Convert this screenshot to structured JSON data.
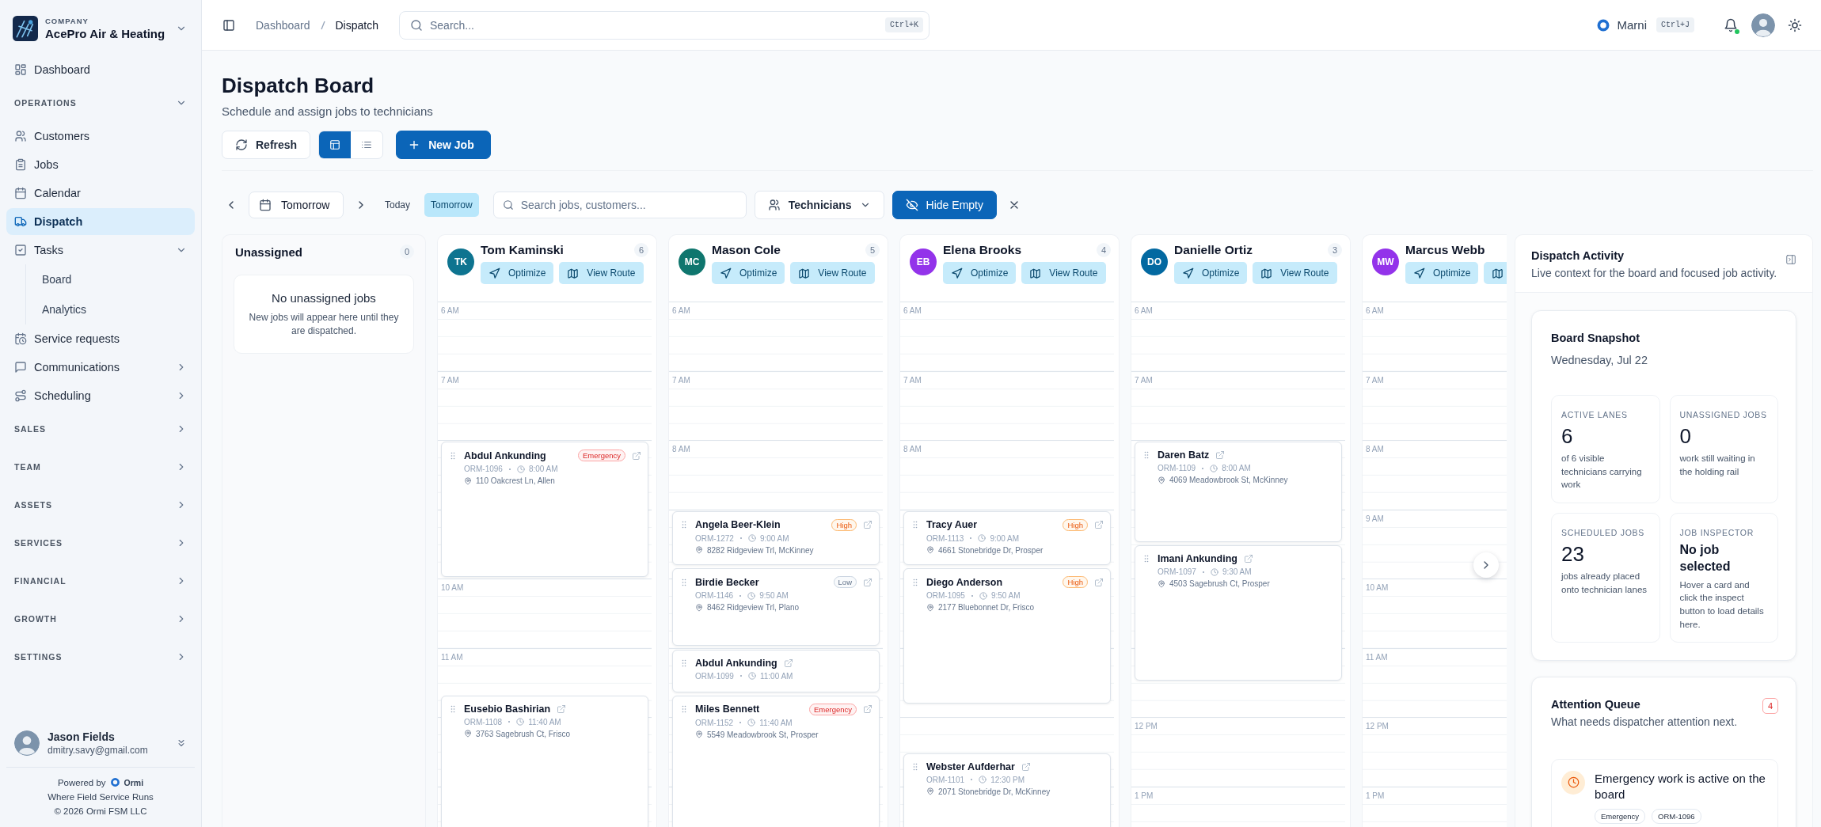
{
  "sidebar": {
    "company_label": "COMPANY",
    "company": "AcePro Air & Heating",
    "nav": [
      {
        "kind": "link",
        "label": "Dashboard",
        "selected": false
      },
      {
        "kind": "section",
        "label": "OPERATIONS",
        "expanded": true,
        "children": [
          {
            "kind": "link",
            "label": "Customers",
            "selected": false
          },
          {
            "kind": "link",
            "label": "Jobs",
            "selected": false
          },
          {
            "kind": "link",
            "label": "Calendar",
            "selected": false
          },
          {
            "kind": "link",
            "label": "Dispatch",
            "selected": true
          },
          {
            "kind": "link",
            "label": "Tasks",
            "selected": false,
            "expanded": true,
            "children": [
              {
                "kind": "sublink",
                "label": "Board",
                "selected": false
              },
              {
                "kind": "sublink",
                "label": "Analytics",
                "selected": false
              }
            ]
          },
          {
            "kind": "link",
            "label": "Service requests",
            "selected": false
          },
          {
            "kind": "link",
            "label": "Communications",
            "selected": false,
            "expanded": false
          },
          {
            "kind": "link",
            "label": "Scheduling",
            "selected": false,
            "expanded": false
          }
        ]
      },
      {
        "kind": "section",
        "label": "SALES",
        "expanded": false
      },
      {
        "kind": "section",
        "label": "TEAM",
        "expanded": false
      },
      {
        "kind": "section",
        "label": "ASSETS",
        "expanded": false
      },
      {
        "kind": "section",
        "label": "SERVICES",
        "expanded": false
      },
      {
        "kind": "section",
        "label": "FINANCIAL",
        "expanded": false
      },
      {
        "kind": "section",
        "label": "GROWTH",
        "expanded": false
      },
      {
        "kind": "section",
        "label": "SETTINGS",
        "expanded": false
      }
    ],
    "user": {
      "name": "Jason Fields",
      "email": "dmitry.savy@gmail.com"
    },
    "footer": {
      "powered_by": "Powered by",
      "brand": "Ormi",
      "tagline": "Where Field Service Runs",
      "copyright": "© 2026 Ormi FSM LLC"
    }
  },
  "header": {
    "breadcrumb": [
      {
        "label": "Dashboard",
        "current": false
      },
      {
        "label": "Dispatch",
        "current": true
      }
    ],
    "search": {
      "placeholder": "Search...",
      "shortcut": "Ctrl+K"
    },
    "assistant": {
      "name": "Marni",
      "shortcut": "Ctrl+J"
    },
    "notifications": {
      "unread": true
    }
  },
  "page": {
    "title": "Dispatch Board",
    "subtitle": "Schedule and assign jobs to technicians",
    "refresh": "Refresh",
    "views": [
      {
        "kind": "board",
        "selected": true
      },
      {
        "kind": "list",
        "selected": false
      }
    ],
    "new_job": "New Job"
  },
  "filters": {
    "date": "Tomorrow",
    "quick_dates": [
      {
        "label": "Today",
        "selected": false
      },
      {
        "label": "Tomorrow",
        "selected": true
      }
    ],
    "search": {
      "placeholder": "Search jobs, customers..."
    },
    "technicians": "Technicians",
    "hide_empty": {
      "label": "Hide Empty",
      "on": true
    }
  },
  "board": {
    "unassigned": {
      "title": "Unassigned",
      "count": "0",
      "empty_title": "No unassigned jobs",
      "empty_text": "New jobs will appear here until they are dispatched."
    },
    "lanes": [
      {
        "initials": "TK",
        "name": "Tom Kaminski",
        "count": "6",
        "color": "#0e7490",
        "actions": [
          {
            "kind": "optimize",
            "label": "Optimize"
          },
          {
            "kind": "route",
            "label": "View Route"
          }
        ],
        "hours": [
          "6 AM",
          "7 AM",
          "10 AM",
          "11 AM"
        ],
        "jobs": [
          {
            "customer": "Abdul Ankunding",
            "priority": {
              "label": "Emergency",
              "kind": "emergency"
            },
            "number": "ORM-1096",
            "time": "8:00 AM",
            "address": "110 Oakcrest Ln, Allen"
          },
          {
            "customer": "Eusebio Bashirian",
            "number": "ORM-1108",
            "time": "11:40 AM",
            "address": "3763 Sagebrush Ct, Frisco"
          }
        ]
      },
      {
        "initials": "MC",
        "name": "Mason Cole",
        "count": "5",
        "color": "#0f766e",
        "actions": [
          {
            "kind": "optimize",
            "label": "Optimize"
          },
          {
            "kind": "route",
            "label": "View Route"
          }
        ],
        "hours": [
          "6 AM",
          "7 AM",
          "8 AM"
        ],
        "jobs": [
          {
            "customer": "Angela Beer-Klein",
            "priority": {
              "label": "High",
              "kind": "high"
            },
            "number": "ORM-1272",
            "time": "9:00 AM",
            "address": "8282 Ridgeview Trl, McKinney"
          },
          {
            "customer": "Birdie Becker",
            "priority": {
              "label": "Low",
              "kind": "low"
            },
            "number": "ORM-1146",
            "time": "9:50 AM",
            "address": "8462 Ridgeview Trl, Plano"
          },
          {
            "customer": "Abdul Ankunding",
            "number": "ORM-1099",
            "time": "11:00 AM"
          },
          {
            "customer": "Miles Bennett",
            "priority": {
              "label": "Emergency",
              "kind": "emergency"
            },
            "number": "ORM-1152",
            "time": "11:40 AM",
            "address": "5549 Meadowbrook St, Prosper"
          }
        ]
      },
      {
        "initials": "EB",
        "name": "Elena Brooks",
        "count": "4",
        "color": "#9333ea",
        "actions": [
          {
            "kind": "optimize",
            "label": "Optimize"
          },
          {
            "kind": "route",
            "label": "View Route"
          }
        ],
        "hours": [
          "6 AM",
          "7 AM",
          "8 AM"
        ],
        "jobs": [
          {
            "customer": "Tracy Auer",
            "priority": {
              "label": "High",
              "kind": "high"
            },
            "number": "ORM-1113",
            "time": "9:00 AM",
            "address": "4661 Stonebridge Dr, Prosper"
          },
          {
            "customer": "Diego Anderson",
            "priority": {
              "label": "High",
              "kind": "high"
            },
            "number": "ORM-1095",
            "time": "9:50 AM",
            "address": "2177 Bluebonnet Dr, Frisco"
          },
          {
            "customer": "Webster Aufderhar",
            "number": "ORM-1101",
            "time": "12:30 PM",
            "address": "2071 Stonebridge Dr, McKinney"
          }
        ]
      },
      {
        "initials": "DO",
        "name": "Danielle Ortiz",
        "count": "3",
        "color": "#0369a1",
        "actions": [
          {
            "kind": "optimize",
            "label": "Optimize"
          },
          {
            "kind": "route",
            "label": "View Route"
          }
        ],
        "hours": [
          "6 AM",
          "7 AM",
          "12 PM",
          "1 PM"
        ],
        "jobs": [
          {
            "customer": "Daren Batz",
            "number": "ORM-1109",
            "time": "8:00 AM",
            "address": "4069 Meadowbrook St, McKinney"
          },
          {
            "customer": "Imani Ankunding",
            "number": "ORM-1097",
            "time": "9:30 AM",
            "address": "4503 Sagebrush Ct, Prosper"
          }
        ]
      },
      {
        "initials": "MW",
        "name": "Marcus Webb",
        "color": "#9333ea",
        "actions": [
          {
            "kind": "optimize",
            "label": "Optimize"
          },
          {
            "kind": "route"
          }
        ],
        "hours": [
          "6 AM",
          "7 AM",
          "8 AM",
          "9 AM",
          "10 AM",
          "11 AM",
          "12 PM",
          "1 PM"
        ]
      }
    ]
  },
  "activity": {
    "title": "Dispatch Activity",
    "description": "Live context for the board and focused job activity.",
    "snapshot": {
      "title": "Board Snapshot",
      "date": "Wednesday, Jul 22",
      "stats": [
        {
          "kind": "number",
          "label": "ACTIVE LANES",
          "value": "6",
          "note": "of 6 visible technicians carrying work"
        },
        {
          "kind": "number",
          "label": "UNASSIGNED JOBS",
          "value": "0",
          "note": "work still waiting in the holding rail"
        },
        {
          "kind": "number",
          "label": "SCHEDULED JOBS",
          "value": "23",
          "note": "jobs already placed onto technician lanes"
        },
        {
          "kind": "text",
          "label": "JOB INSPECTOR",
          "value": "No job selected",
          "note": "Hover a card and click the inspect button to load details here."
        }
      ]
    },
    "attention": {
      "title": "Attention Queue",
      "count": "4",
      "description": "What needs dispatcher attention next.",
      "items": [
        {
          "title": "Emergency work is active on the board",
          "tags": [
            "Emergency",
            "ORM-1096"
          ]
        }
      ]
    }
  }
}
